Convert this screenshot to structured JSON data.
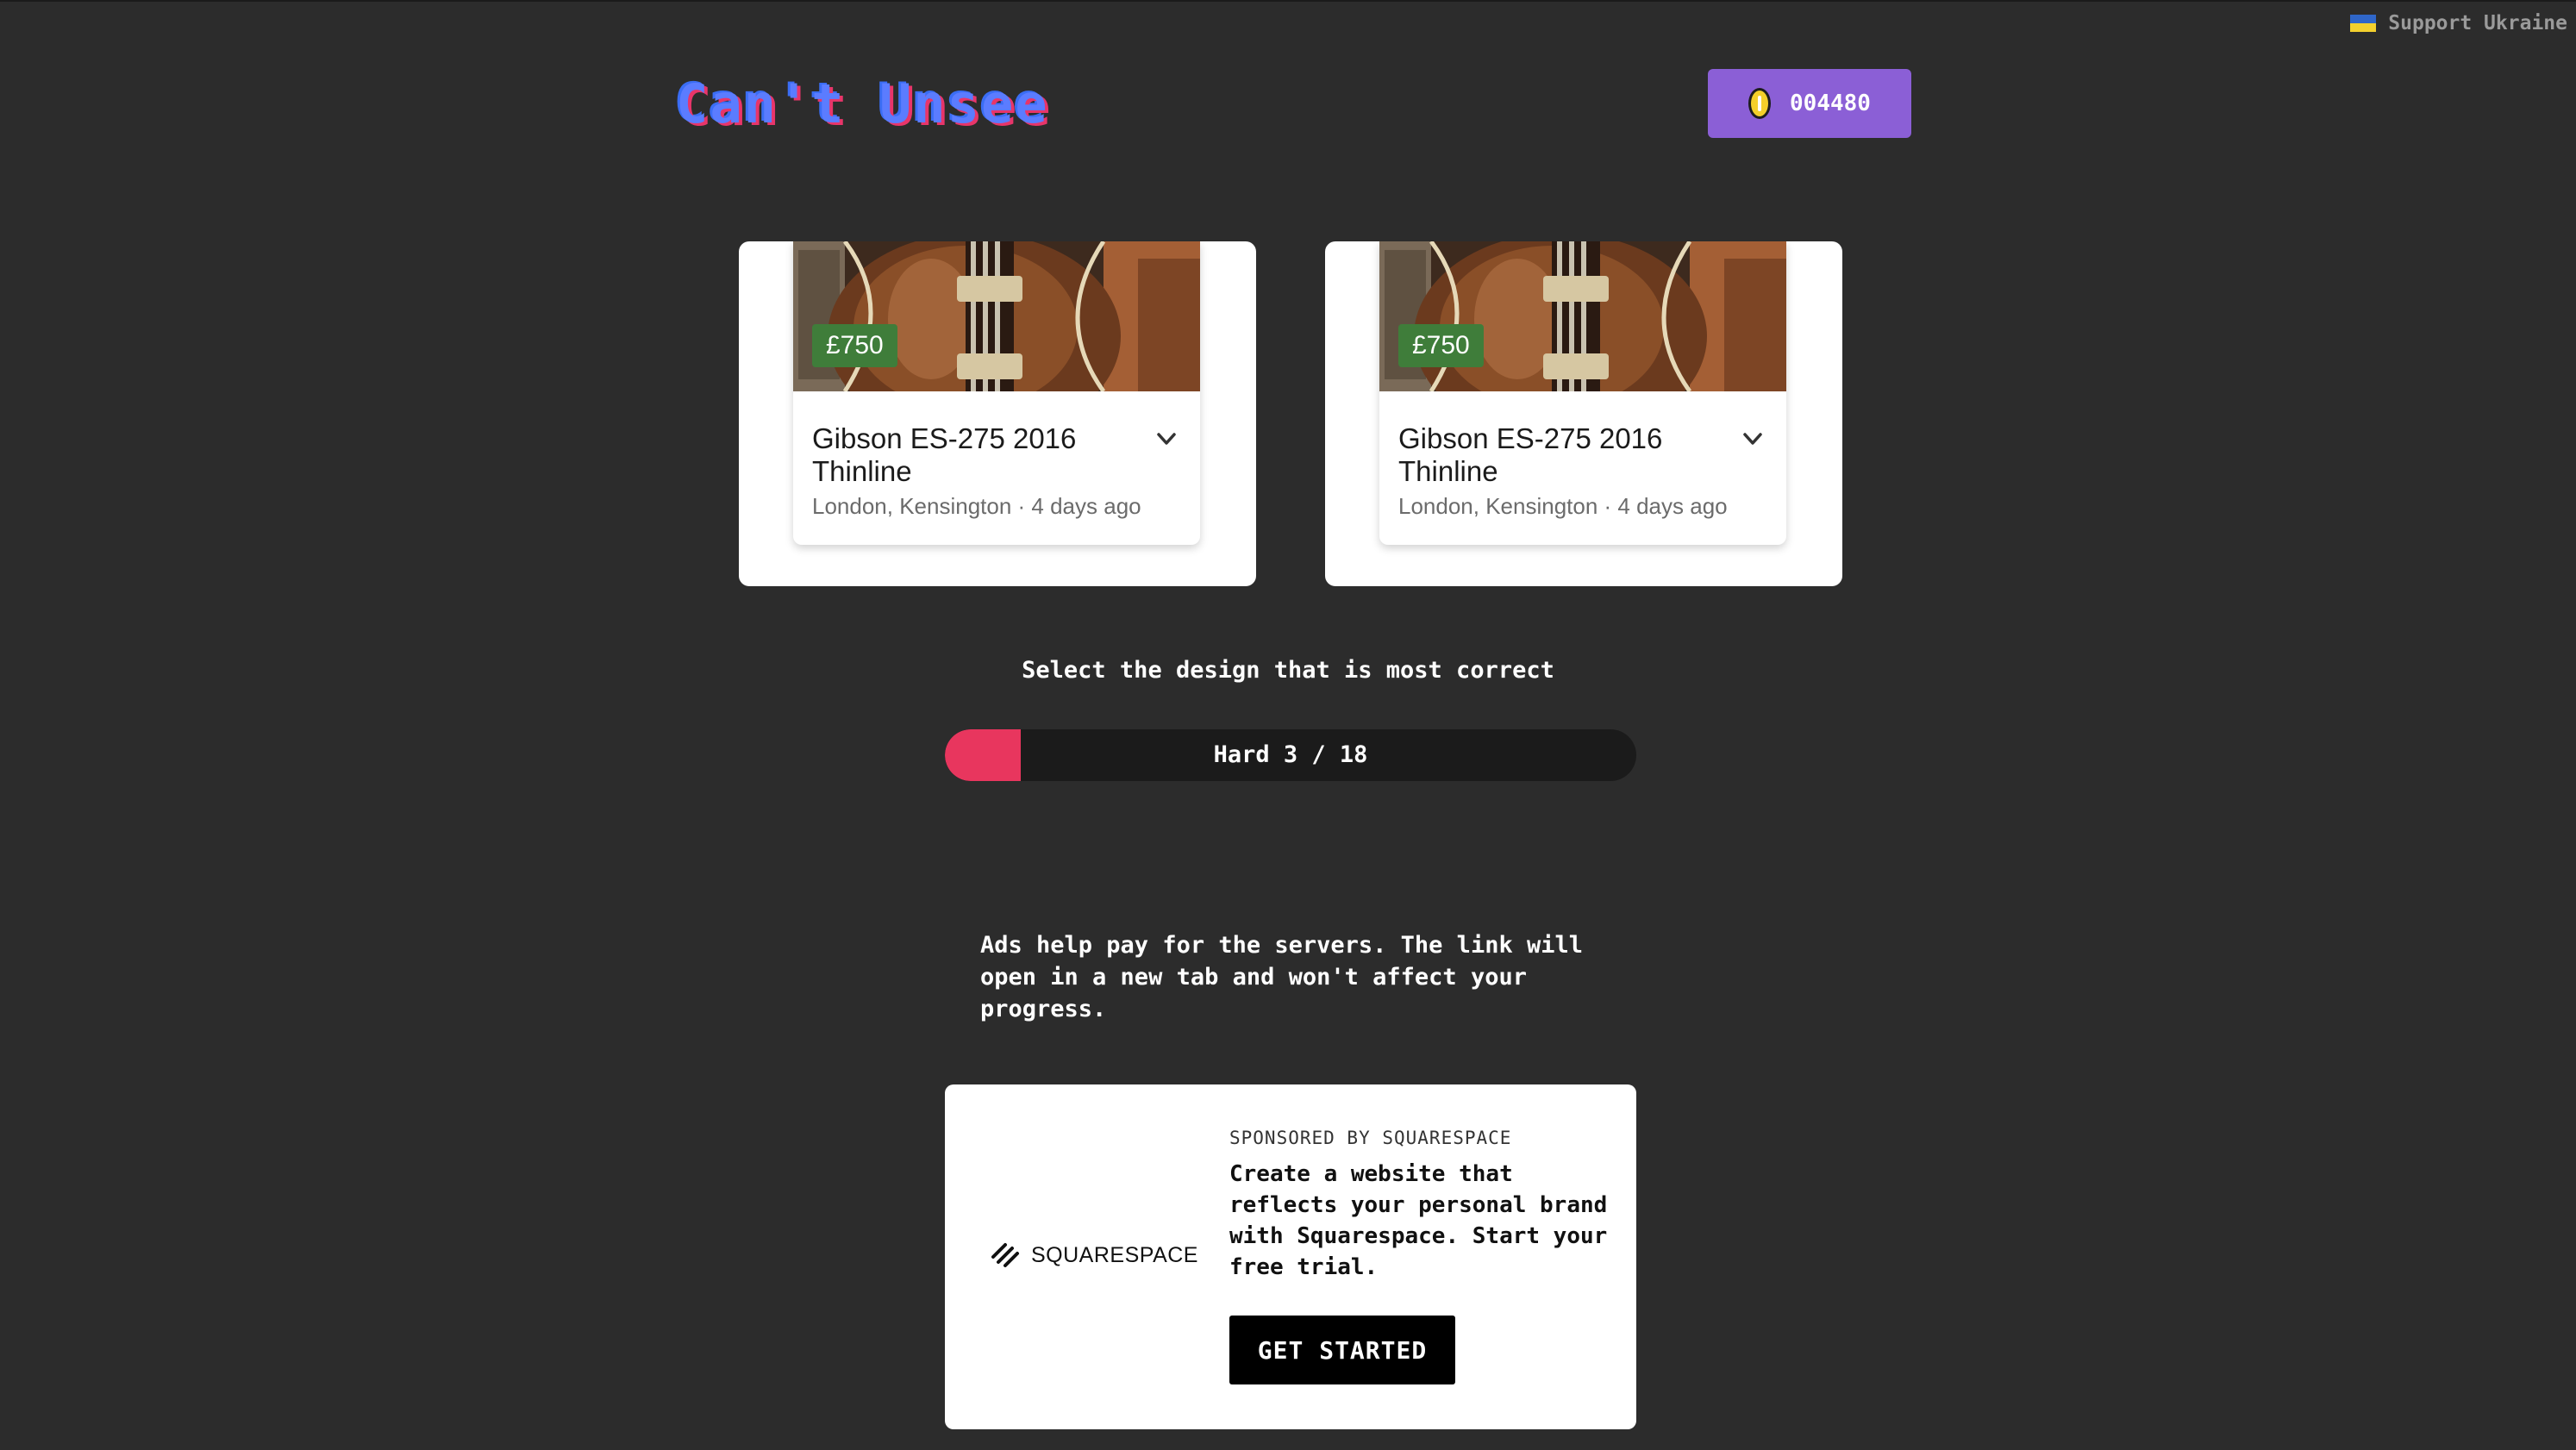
{
  "app": {
    "logo_text": "Can't Unsee",
    "support_link": "Support Ukraine",
    "coins": "004480"
  },
  "options": [
    {
      "price": "£750",
      "title": "Gibson ES-275 2016 Thinline",
      "meta": "London, Kensington · 4 days ago"
    },
    {
      "price": "£750",
      "title": "Gibson ES-275 2016 Thinline",
      "meta": "London, Kensington · 4 days ago"
    }
  ],
  "game": {
    "prompt": "Select the design that is most correct",
    "progress_label": "Hard 3 / 18",
    "progress_value": 0.11
  },
  "ads": {
    "note": "Ads help pay for the servers. The link will open in a new tab and won't affect your progress.",
    "logo_text": "SQUARESPACE",
    "sponsor_label": "SPONSORED BY SQUARESPACE",
    "copy": "Create a website that reflects your personal brand with Squarespace. Start your free trial.",
    "button_label": "GET STARTED"
  },
  "colors": {
    "background": "#2c2c2c",
    "coin_badge": "#8b5fd6",
    "progress_fill": "#e8365e",
    "price_tag": "#3f7d3a"
  },
  "icons": {
    "coin": "coin-icon",
    "flag": "ukraine-flag-icon",
    "expand": "chevron-down-icon",
    "sponsor_logo": "squarespace-logo-icon"
  }
}
